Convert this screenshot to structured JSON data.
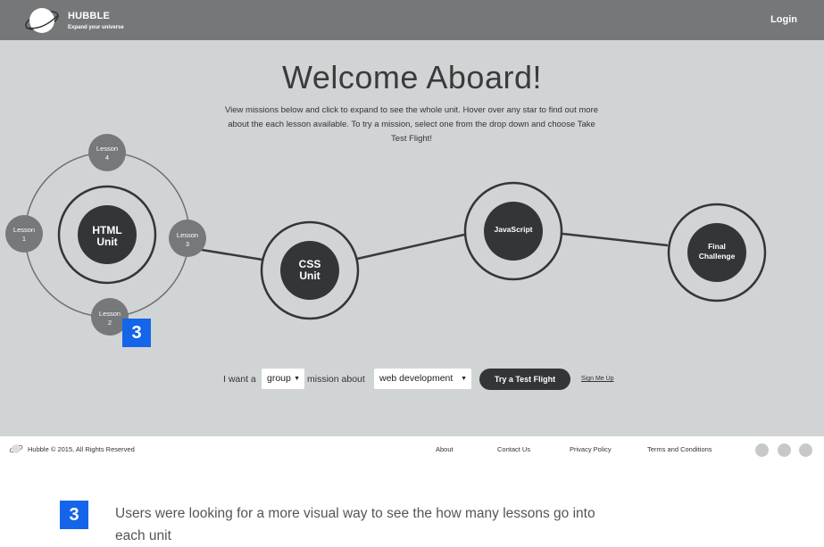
{
  "header": {
    "brand_name": "HUBBLE",
    "brand_tagline": "Expand your universe",
    "login_label": "Login"
  },
  "main": {
    "title": "Welcome Aboard!",
    "intro": "View missions below and click to expand to see the whole unit. Hover over any star to find out more about the each lesson available. To try a mission, select one from the drop down and choose Take Test Flight!"
  },
  "map": {
    "units": [
      {
        "line1": "HTML",
        "line2": "Unit"
      },
      {
        "line1": "CSS",
        "line2": "Unit"
      },
      {
        "line1": "JavaScript",
        "line2": ""
      },
      {
        "line1": "Final",
        "line2": "Challenge"
      }
    ],
    "lessons": [
      {
        "label": "Lesson",
        "num": "1"
      },
      {
        "label": "Lesson",
        "num": "2"
      },
      {
        "label": "Lesson",
        "num": "3"
      },
      {
        "label": "Lesson",
        "num": "4"
      }
    ]
  },
  "form": {
    "prefix": "I want a",
    "type_value": "group",
    "middle": "mission about",
    "topic_value": "web development",
    "cta_label": "Try a Test Flight",
    "signup_label": "Sign Me Up"
  },
  "footer": {
    "copyright": "Hubble © 2015, All Rights Reserved",
    "links": [
      "About",
      "Contact Us",
      "Privacy Policy",
      "Terms and Conditions"
    ]
  },
  "annotation": {
    "badge": "3",
    "note": "Users were looking for a more visual way to see the how many lessons go into each unit"
  },
  "colors": {
    "header_bg": "#757779",
    "main_bg": "#d1d4d5",
    "node_dark": "#333538",
    "lesson_gray": "#76787a",
    "badge_blue": "#1565ea"
  },
  "icons": {
    "logo": "planet-logo-icon",
    "caret": "caret-down-icon",
    "social": "social-circle-icon"
  }
}
